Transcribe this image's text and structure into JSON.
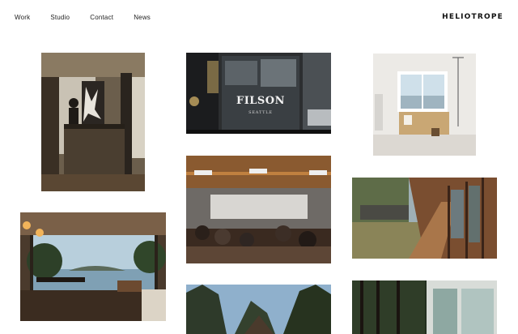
{
  "nav": {
    "items": [
      {
        "label": "Work"
      },
      {
        "label": "Studio"
      },
      {
        "label": "Contact"
      },
      {
        "label": "News"
      }
    ]
  },
  "brand": {
    "logo": "HELIOTROPE"
  },
  "gallery": {
    "projects": [
      {
        "name": "interior-dark-kitchen"
      },
      {
        "name": "filson-storefront",
        "sign_text": "FILSON",
        "sign_subtext": "SEATTLE"
      },
      {
        "name": "white-bathroom"
      },
      {
        "name": "restaurant-dining-hall"
      },
      {
        "name": "cabin-deck-walkway"
      },
      {
        "name": "lakeview-dining-room"
      },
      {
        "name": "forest-cabin-roof"
      },
      {
        "name": "forest-glass-house"
      }
    ]
  },
  "colors": {
    "background": "#ffffff",
    "text": "#1a1a1a"
  }
}
